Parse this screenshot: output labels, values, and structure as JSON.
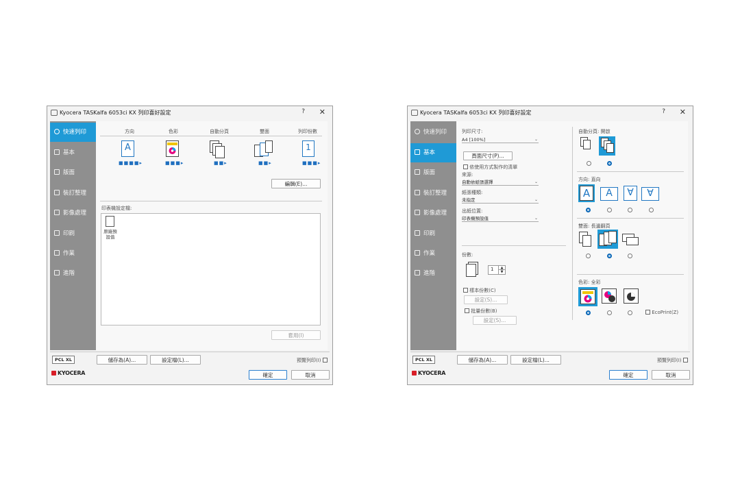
{
  "left_dialog": {
    "title": "Kyocera TASKalfa 6053ci KX 列印喜好設定",
    "help": "?",
    "close": "✕",
    "sidebar": [
      {
        "label": "快速列印",
        "icon": "clock-icon",
        "active": true
      },
      {
        "label": "基本",
        "icon": "basic-icon"
      },
      {
        "label": "版面",
        "icon": "layout-icon"
      },
      {
        "label": "裝訂整理",
        "icon": "finishing-icon"
      },
      {
        "label": "影像處理",
        "icon": "imaging-icon"
      },
      {
        "label": "印刷",
        "icon": "publishing-icon"
      },
      {
        "label": "作業",
        "icon": "job-icon"
      },
      {
        "label": "進階",
        "icon": "advanced-icon"
      }
    ],
    "quick_headers": [
      "方向",
      "色彩",
      "自動分頁",
      "雙面",
      "列印份數"
    ],
    "quick_icons": [
      "orientation-icon",
      "color-icon",
      "collate-icon",
      "duplex-icon",
      "copies-icon"
    ],
    "orientation_letter": "A",
    "copies_value": "1",
    "edit_button": "編輯(E)...",
    "profiles_label": "印表機設定檔:",
    "profile_item": "原廠預設值",
    "apply_button": "套用(I)",
    "pcl": "PCL XL",
    "save_button": "儲存為(A)...",
    "profile_button": "設定檔(L)...",
    "preview_label": "預覽列印(I)",
    "logo": "KYOCERA",
    "ok": "確定",
    "cancel": "取消"
  },
  "right_dialog": {
    "title": "Kyocera TASKalfa 6053ci KX 列印喜好設定",
    "help": "?",
    "close": "✕",
    "sidebar": [
      {
        "label": "快速列印",
        "icon": "clock-icon"
      },
      {
        "label": "基本",
        "icon": "basic-icon",
        "active": true
      },
      {
        "label": "版面",
        "icon": "layout-icon"
      },
      {
        "label": "裝訂整理",
        "icon": "finishing-icon"
      },
      {
        "label": "影像處理",
        "icon": "imaging-icon"
      },
      {
        "label": "印刷",
        "icon": "publishing-icon"
      },
      {
        "label": "作業",
        "icon": "job-icon"
      },
      {
        "label": "進階",
        "icon": "advanced-icon"
      }
    ],
    "print_size_label": "列印尺寸:",
    "print_size_value": "A4 [100%]",
    "page_size_button": "頁面尺寸(P)...",
    "by_method_label": "依使用方式製作的清單",
    "source_label": "來源:",
    "source_value": "自動依紙張選擇",
    "media_label": "紙張種類:",
    "media_value": "未指定",
    "output_label": "出紙位置:",
    "output_value": "印表機預設值",
    "copies_label": "份數:",
    "copies_value": "1",
    "proof_label": "樣本份數(C)",
    "proof_settings": "設定(S)...",
    "batch_label": "批量份數(B)",
    "batch_settings": "設定(S)...",
    "collate_label": "自動分頁: 開啟",
    "orientation_label": "方向: 直向",
    "orientation_letters": [
      "A",
      "A",
      "∀",
      "∀"
    ],
    "duplex_label": "雙面: 長邊翻頁",
    "color_label": "色彩: 全彩",
    "ecoprint_label": "EcoPrint(Z)",
    "pcl": "PCL XL",
    "save_button": "儲存為(A)...",
    "profile_button": "設定檔(L)...",
    "preview_label": "預覽列印(I)",
    "logo": "KYOCERA",
    "ok": "確定",
    "cancel": "取消"
  }
}
